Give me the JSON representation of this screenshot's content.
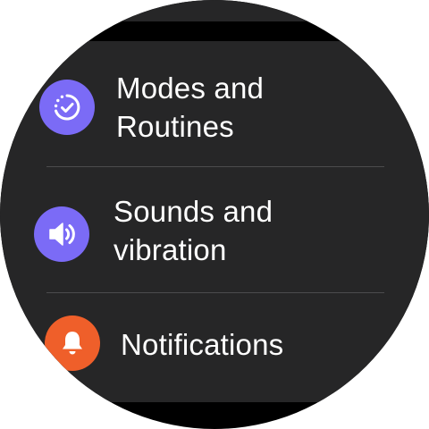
{
  "colors": {
    "background": "#000000",
    "card": "#262627",
    "divider": "#4b4b4d",
    "text": "#ffffff",
    "modes_icon": "#7b6bf6",
    "sounds_icon": "#7b6bf6",
    "notifications_icon": "#ef5f2a"
  },
  "menu": {
    "items": [
      {
        "line1": "Modes and",
        "line2": "Routines",
        "icon": "modes-routines-icon"
      },
      {
        "line1": "Sounds and",
        "line2": "vibration",
        "icon": "volume-icon"
      },
      {
        "line1": "Notifications",
        "icon": "bell-icon"
      }
    ]
  }
}
